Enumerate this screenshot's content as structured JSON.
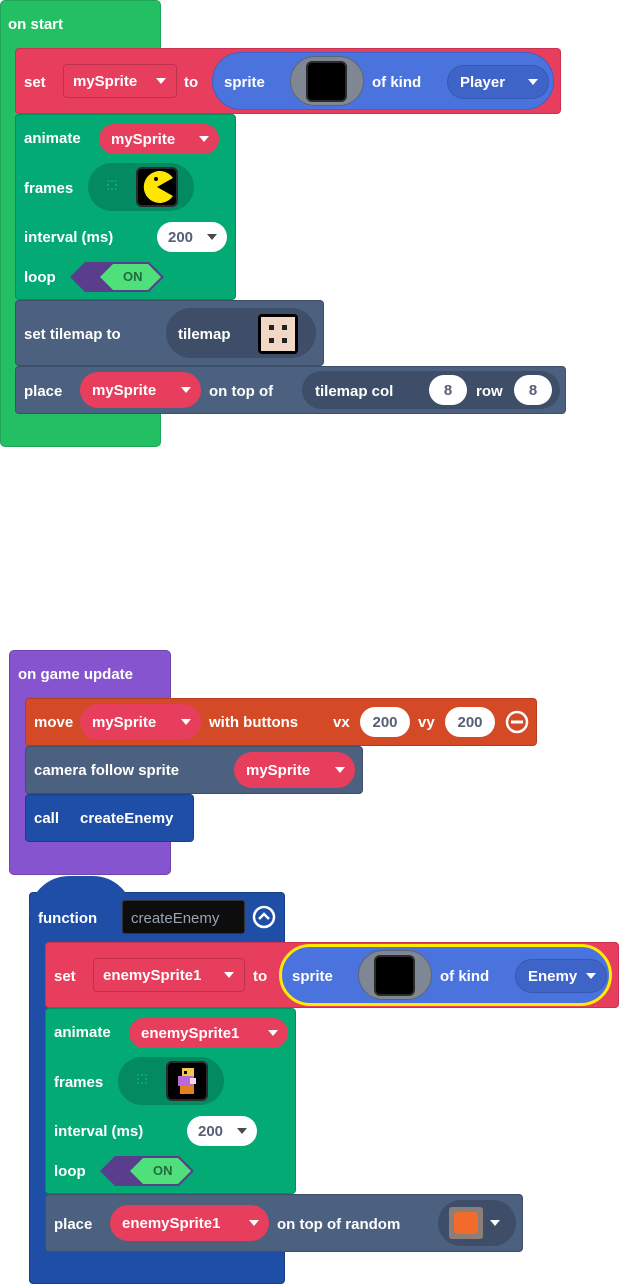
{
  "on_start": {
    "hat_label": "on start",
    "set_block": {
      "set_label": "set",
      "variable": "mySprite",
      "to_label": "to",
      "sprite_label": "sprite",
      "of_kind_label": "of kind",
      "kind": "Player"
    },
    "animate_block": {
      "animate_label": "animate",
      "variable": "mySprite",
      "frames_label": "frames",
      "interval_label": "interval (ms)",
      "interval_value": "200",
      "loop_label": "loop",
      "loop_value": "ON"
    },
    "tilemap_block": {
      "label": "set tilemap to",
      "tilemap_label": "tilemap"
    },
    "place_block": {
      "place_label": "place",
      "variable": "mySprite",
      "on_top_of_label": "on top of",
      "tilemap_col_label": "tilemap col",
      "col_value": "8",
      "row_label": "row",
      "row_value": "8"
    }
  },
  "on_game_update": {
    "hat_label": "on game update",
    "move_block": {
      "move_label": "move",
      "variable": "mySprite",
      "with_buttons_label": "with buttons",
      "vx_label": "vx",
      "vx_value": "200",
      "vy_label": "vy",
      "vy_value": "200"
    },
    "camera_block": {
      "label": "camera follow sprite",
      "variable": "mySprite"
    },
    "call_block": {
      "call_label": "call",
      "function_name": "createEnemy"
    }
  },
  "function_def": {
    "function_label": "function",
    "name": "createEnemy",
    "set_block": {
      "set_label": "set",
      "variable": "enemySprite1",
      "to_label": "to",
      "sprite_label": "sprite",
      "of_kind_label": "of kind",
      "kind": "Enemy"
    },
    "animate_block": {
      "animate_label": "animate",
      "variable": "enemySprite1",
      "frames_label": "frames",
      "interval_label": "interval (ms)",
      "interval_value": "200",
      "loop_label": "loop",
      "loop_value": "ON"
    },
    "place_block": {
      "place_label": "place",
      "variable": "enemySprite1",
      "on_top_of_random_label": "on top of random"
    }
  },
  "colors": {
    "events_green": "#23c063",
    "variables_red": "#e63e5c",
    "sprites_blue": "#4b73de",
    "animation_green": "#03aa74",
    "scene_slate": "#4c607f",
    "controller_orange": "#d44a26",
    "functions_purple": "#8754cf",
    "functions_darkblue": "#1e4ea6",
    "highlight_yellow": "#ffea00"
  }
}
